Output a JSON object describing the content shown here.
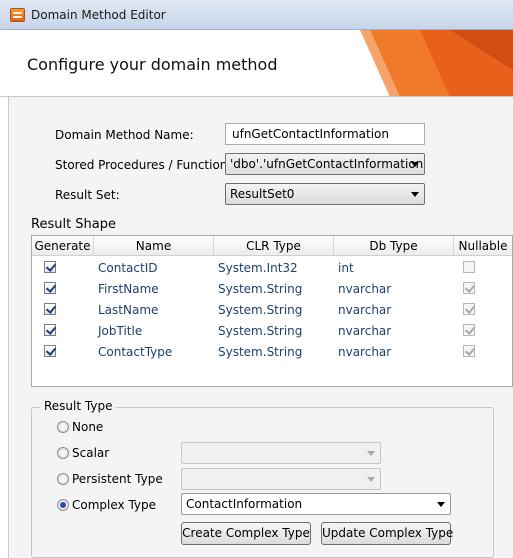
{
  "window": {
    "title": "Domain Method Editor",
    "icon": "domain-method-app-icon"
  },
  "header": {
    "heading": "Configure your domain method",
    "accent_color": "#e8601c"
  },
  "form": {
    "method_name": {
      "label": "Domain Method Name:",
      "value": "ufnGetContactInformation"
    },
    "stored_procedure": {
      "label": "Stored Procedures / Functions",
      "value": "'dbo'.'ufnGetContactInformation'"
    },
    "result_set": {
      "label": "Result Set:",
      "value": "ResultSet0"
    }
  },
  "result_shape": {
    "title": "Result Shape",
    "columns": [
      "Generate",
      "Name",
      "CLR Type",
      "Db Type",
      "Nullable"
    ],
    "rows": [
      {
        "generate": true,
        "name": "ContactID",
        "clr_type": "System.Int32",
        "db_type": "int",
        "nullable": false
      },
      {
        "generate": true,
        "name": "FirstName",
        "clr_type": "System.String",
        "db_type": "nvarchar",
        "nullable": true
      },
      {
        "generate": true,
        "name": "LastName",
        "clr_type": "System.String",
        "db_type": "nvarchar",
        "nullable": true
      },
      {
        "generate": true,
        "name": "JobTitle",
        "clr_type": "System.String",
        "db_type": "nvarchar",
        "nullable": true
      },
      {
        "generate": true,
        "name": "ContactType",
        "clr_type": "System.String",
        "db_type": "nvarchar",
        "nullable": true
      }
    ]
  },
  "result_type": {
    "title": "Result Type",
    "options": [
      {
        "label": "None",
        "selected": false
      },
      {
        "label": "Scalar",
        "selected": false
      },
      {
        "label": "Persistent Type",
        "selected": false
      },
      {
        "label": "Complex Type",
        "selected": true
      }
    ],
    "scalar_value": "",
    "persistent_value": "",
    "complex_value": "ContactInformation",
    "create_button": "Create Complex Type",
    "update_button": "Update Complex Type"
  }
}
